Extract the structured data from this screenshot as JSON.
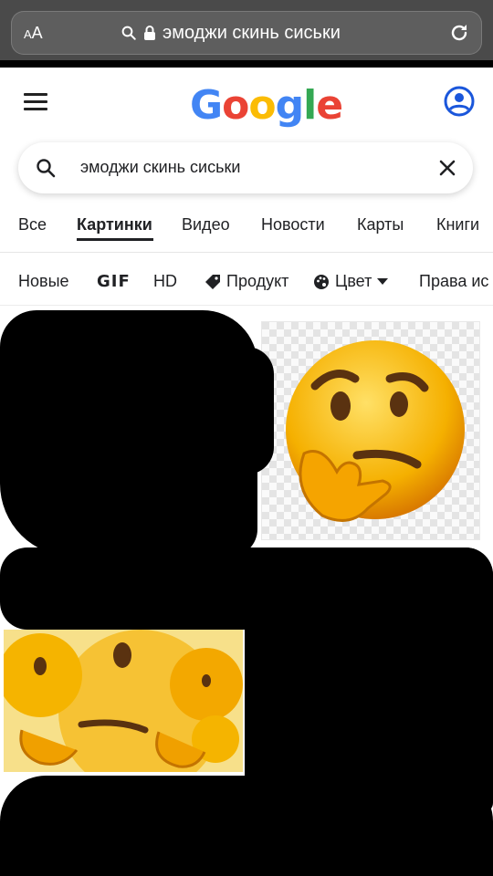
{
  "browser": {
    "text_size_label_small": "A",
    "text_size_label_large": "A",
    "url_text": "эмоджи скинь сиськи",
    "icons": [
      "search-icon",
      "lock-icon",
      "reload-icon"
    ]
  },
  "google": {
    "logo_text": "Google",
    "logo_colors": [
      "#4285F4",
      "#EA4335",
      "#FBBC05",
      "#4285F4",
      "#34A853",
      "#EA4335"
    ],
    "icons": [
      "hamburger-icon",
      "account-icon"
    ]
  },
  "search": {
    "query": "эмоджи скинь сиськи",
    "icons": [
      "search-icon",
      "clear-icon"
    ]
  },
  "tabs": [
    {
      "label": "Все",
      "active": false
    },
    {
      "label": "Картинки",
      "active": true
    },
    {
      "label": "Видео",
      "active": false
    },
    {
      "label": "Новости",
      "active": false
    },
    {
      "label": "Карты",
      "active": false
    },
    {
      "label": "Книги",
      "active": false
    }
  ],
  "filters": [
    {
      "label": "Новые"
    },
    {
      "label": "GIF"
    },
    {
      "label": "HD"
    },
    {
      "label": "Продукт",
      "icon": "tag-icon"
    },
    {
      "label": "Цвет",
      "icon": "palette-icon",
      "dropdown": true
    },
    {
      "label": "Права ис"
    }
  ],
  "results": {
    "thumbnails": [
      "thinking-emoji",
      "thinking-emoji-collage"
    ]
  }
}
